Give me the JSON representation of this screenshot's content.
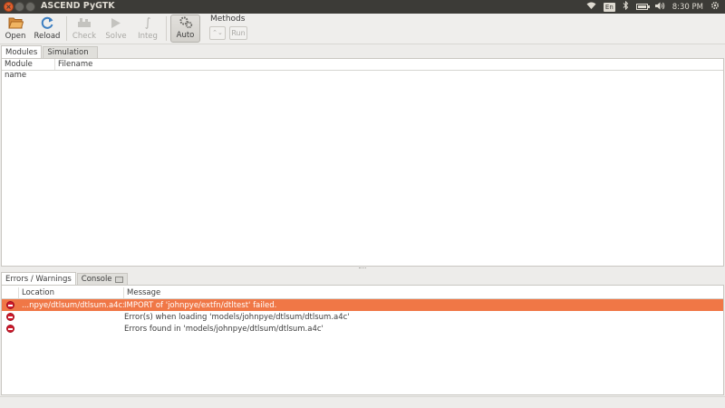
{
  "window": {
    "title": "ASCEND PyGTK",
    "controls": [
      "close-icon",
      "minimize-icon",
      "maximize-icon"
    ]
  },
  "tray": {
    "keyboard_layout": "En",
    "time": "8:30 PM",
    "icons": [
      "wifi-icon",
      "keyboard-icon",
      "bluetooth-icon",
      "battery-icon",
      "volume-icon",
      "gear-icon"
    ]
  },
  "toolbar": {
    "open_label": "Open",
    "reload_label": "Reload",
    "check_label": "Check",
    "solve_label": "Solve",
    "integ_label": "Integ",
    "auto_label": "Auto",
    "methods_label": "Methods",
    "run_label": "Run"
  },
  "top_tabs": [
    {
      "label": "Modules",
      "active": true
    },
    {
      "label": "Simulation",
      "active": false
    }
  ],
  "modules_table": {
    "columns": [
      "Module name",
      "Filename"
    ],
    "rows": []
  },
  "bottom_tabs": [
    {
      "label": "Errors / Warnings",
      "active": true
    },
    {
      "label": "Console",
      "active": false
    }
  ],
  "errors_table": {
    "columns": [
      "",
      "Location",
      "Message"
    ],
    "rows": [
      {
        "icon": "error-icon",
        "location": "...npye/dtlsum/dtlsum.a4c:2",
        "message": "IMPORT of 'johnpye/extfn/dtltest' failed.",
        "selected": true
      },
      {
        "icon": "error-icon",
        "location": "",
        "message": "Error(s) when loading 'models/johnpye/dtlsum/dtlsum.a4c'",
        "selected": false
      },
      {
        "icon": "error-icon",
        "location": "",
        "message": "Errors found in 'models/johnpye/dtlsum/dtlsum.a4c'",
        "selected": false
      }
    ]
  },
  "colors": {
    "titlebar": "#3c3b37",
    "close_button": "#e2612f",
    "selection": "#f07746",
    "error_red": "#d0192a",
    "window_bg": "#edecea"
  }
}
